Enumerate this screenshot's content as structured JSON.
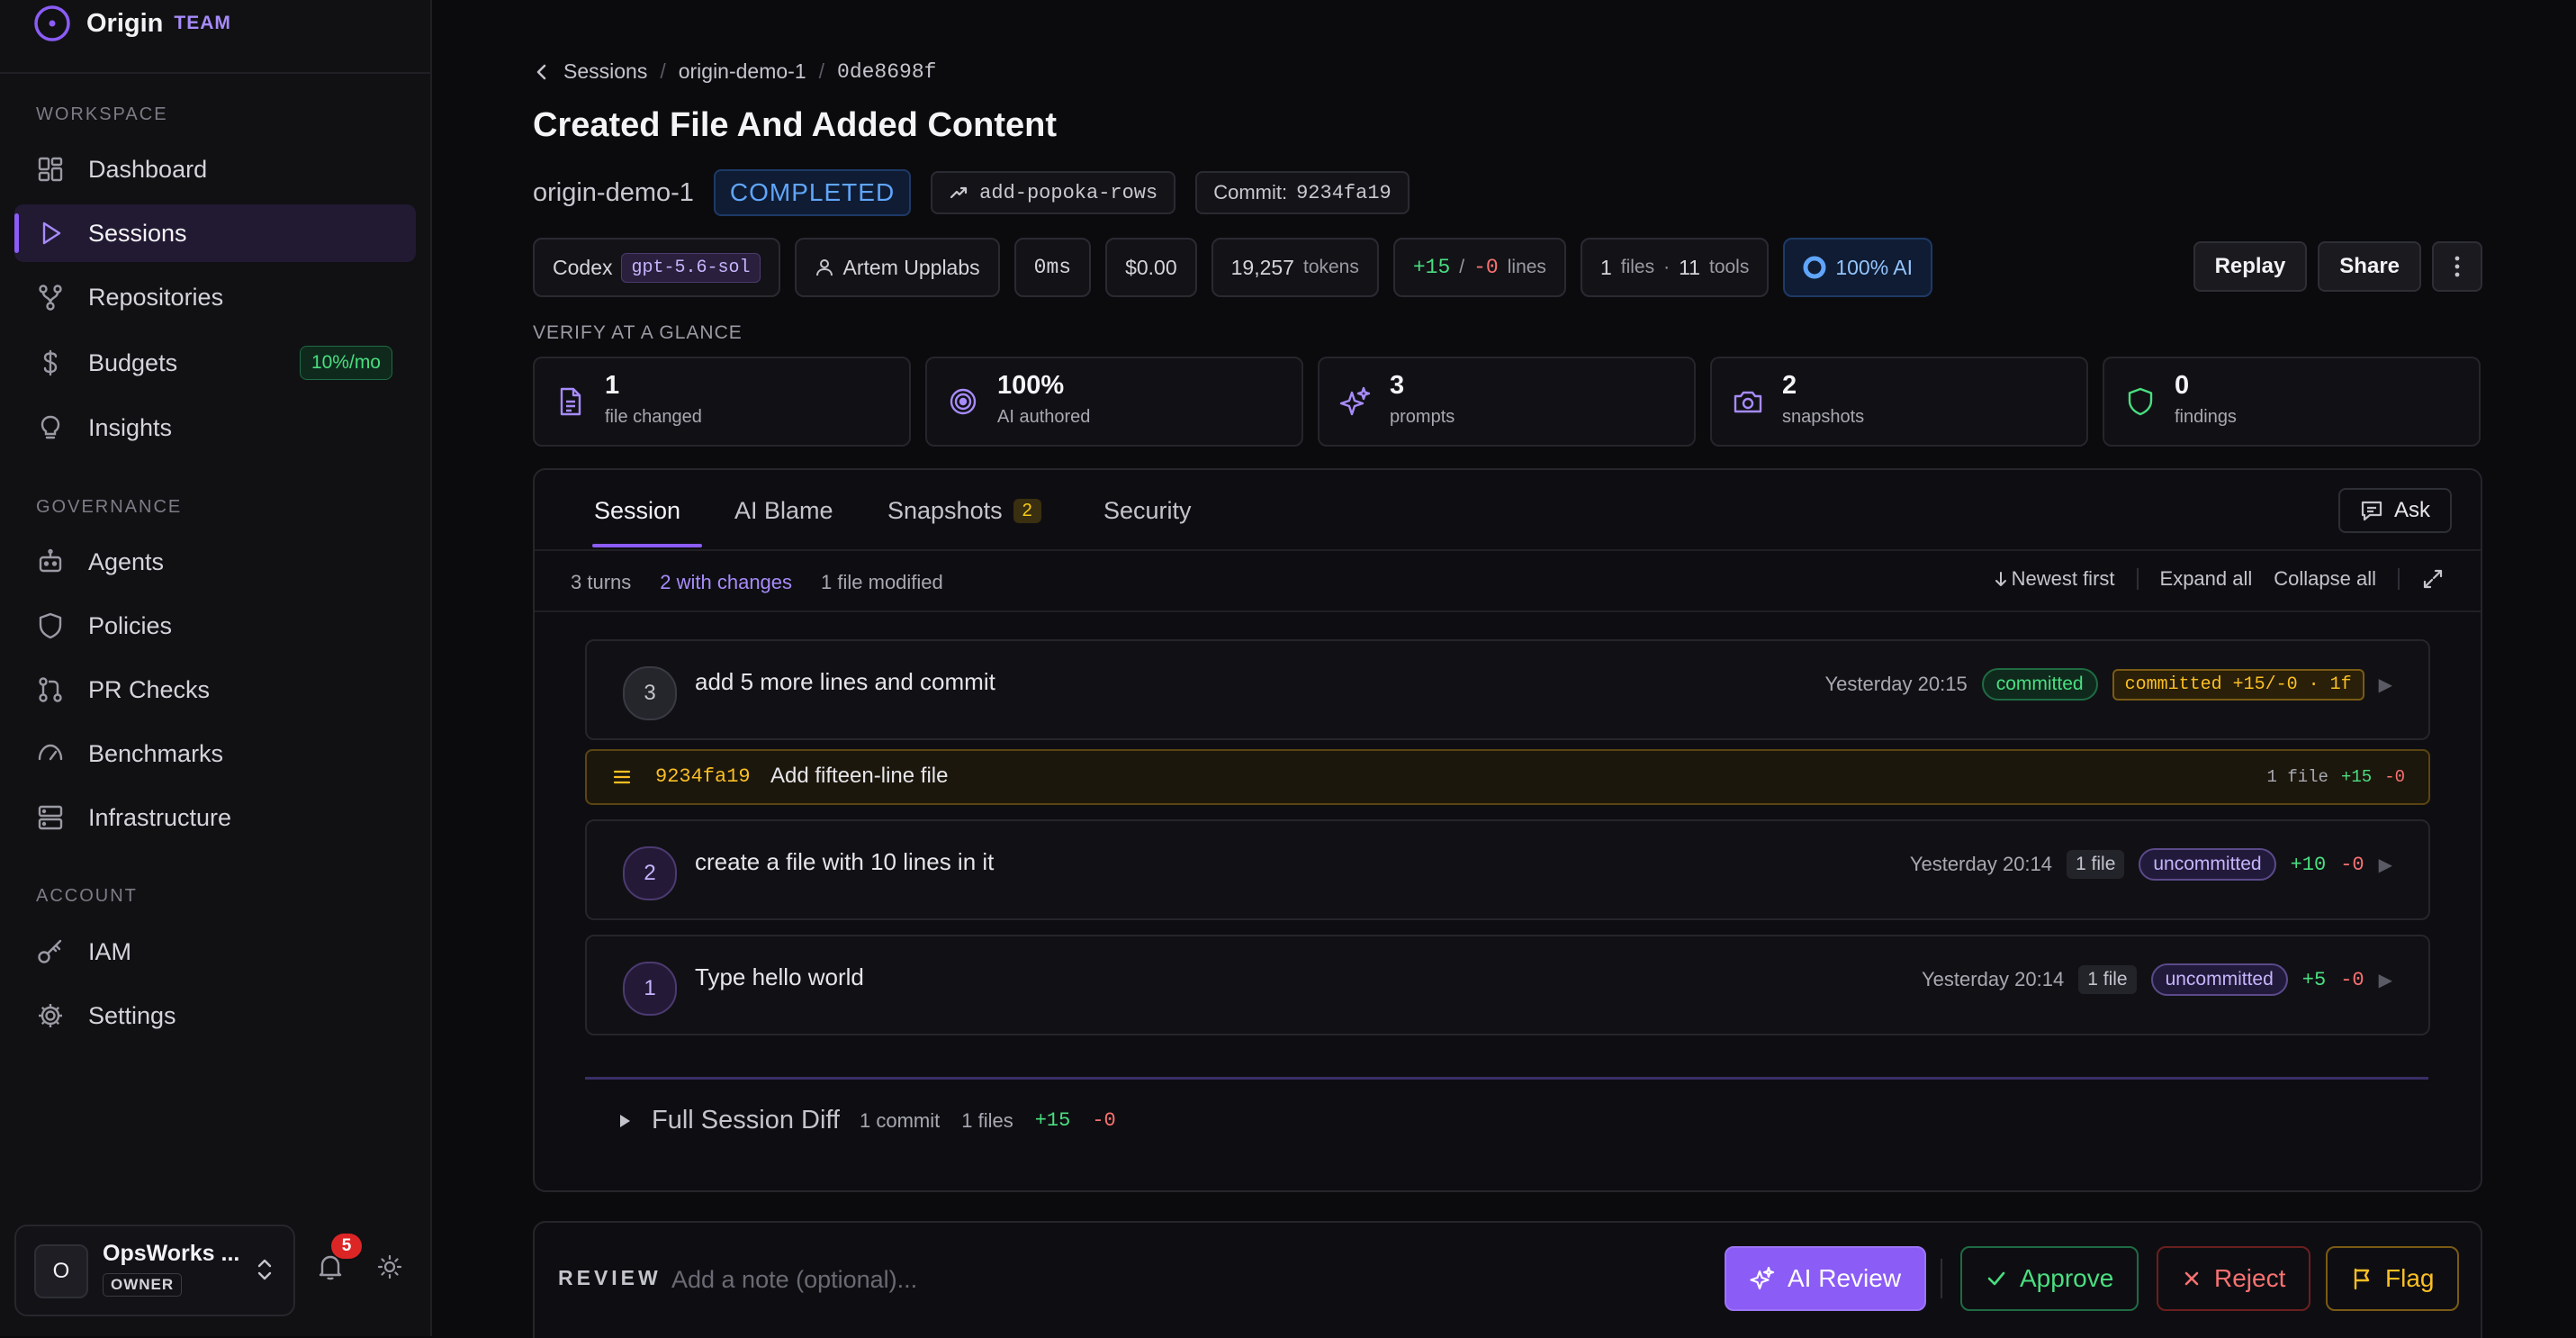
{
  "brand": {
    "name": "Origin",
    "tier": "TEAM"
  },
  "sidebar": {
    "sections": [
      {
        "label": "WORKSPACE"
      },
      {
        "label": "GOVERNANCE"
      },
      {
        "label": "ACCOUNT"
      }
    ],
    "items": [
      {
        "label": "Dashboard",
        "icon": "dashboard-icon"
      },
      {
        "label": "Sessions",
        "icon": "play-icon",
        "active": true
      },
      {
        "label": "Repositories",
        "icon": "git-branch-icon"
      },
      {
        "label": "Budgets",
        "icon": "dollar-icon",
        "badge": "10%/mo"
      },
      {
        "label": "Insights",
        "icon": "lightbulb-icon"
      },
      {
        "label": "Agents",
        "icon": "robot-icon"
      },
      {
        "label": "Policies",
        "icon": "shield-icon"
      },
      {
        "label": "PR Checks",
        "icon": "pull-request-icon"
      },
      {
        "label": "Benchmarks",
        "icon": "gauge-icon"
      },
      {
        "label": "Infrastructure",
        "icon": "server-icon"
      },
      {
        "label": "IAM",
        "icon": "key-icon"
      },
      {
        "label": "Settings",
        "icon": "gear-icon"
      }
    ],
    "user": {
      "initial": "O",
      "name": "OpsWorks ...",
      "role": "OWNER"
    },
    "notifications": "5"
  },
  "breadcrumb": [
    "Sessions",
    "origin-demo-1",
    "0de8698f"
  ],
  "session": {
    "title": "Created File And Added Content",
    "project": "origin-demo-1",
    "status": "COMPLETED",
    "branch": "add-popoka-rows",
    "commit_label": "Commit:",
    "commit_hash": "9234fa19"
  },
  "stats": {
    "agent": "Codex",
    "model": "gpt-5.6-sol",
    "user": "Artem Upplabs",
    "duration": "0ms",
    "cost": "$0.00",
    "tokens": "19,257",
    "tokens_label": "tokens",
    "added": "+15",
    "removed": "-0",
    "lines_label": "lines",
    "files": "1",
    "files_label": "files",
    "tools": "11",
    "tools_label": "tools",
    "ai_pct": "100% AI"
  },
  "actions": {
    "replay": "Replay",
    "share": "Share"
  },
  "glance": {
    "label": "VERIFY AT A GLANCE",
    "cards": [
      {
        "value": "1",
        "label": "file changed",
        "icon": "file-icon"
      },
      {
        "value": "100%",
        "label": "AI authored",
        "icon": "target-icon"
      },
      {
        "value": "3",
        "label": "prompts",
        "icon": "sparkles-icon"
      },
      {
        "value": "2",
        "label": "snapshots",
        "icon": "camera-icon"
      },
      {
        "value": "0",
        "label": "findings",
        "icon": "shield-icon"
      }
    ]
  },
  "tabs": [
    {
      "label": "Session",
      "active": true
    },
    {
      "label": "AI Blame"
    },
    {
      "label": "Snapshots",
      "count": "2"
    },
    {
      "label": "Security"
    }
  ],
  "ask": "Ask",
  "summary": {
    "turns": "3 turns",
    "with_changes": "2 with changes",
    "modified": "1 file modified",
    "sort": "Newest first",
    "expand": "Expand all",
    "collapse": "Collapse all"
  },
  "turns": [
    {
      "num": "3",
      "prompt": "add 5 more lines and commit",
      "time": "Yesterday 20:15",
      "status": "committed",
      "detail": "committed +15/-0 · 1f"
    },
    {
      "num": "2",
      "prompt": "create a file with 10 lines in it",
      "time": "Yesterday 20:14",
      "files": "1 file",
      "status": "uncommitted",
      "added": "+10",
      "removed": "-0"
    },
    {
      "num": "1",
      "prompt": "Type hello world",
      "time": "Yesterday 20:14",
      "files": "1 file",
      "status": "uncommitted",
      "added": "+5",
      "removed": "-0"
    }
  ],
  "commit": {
    "hash": "9234fa19",
    "message": "Add fifteen-line file",
    "files": "1 file",
    "added": "+15",
    "removed": "-0"
  },
  "full_diff": {
    "title": "Full Session Diff",
    "commits": "1 commit",
    "files": "1 files",
    "added": "+15",
    "removed": "-0"
  },
  "review": {
    "label": "REVIEW",
    "placeholder": "Add a note (optional)...",
    "ai_review": "AI Review",
    "approve": "Approve",
    "reject": "Reject",
    "flag": "Flag"
  },
  "colors": {
    "accent": "#8b5cf6",
    "success": "#4ade80",
    "danger": "#f87171",
    "warning": "#fbbf24",
    "info": "#60a5fa"
  }
}
